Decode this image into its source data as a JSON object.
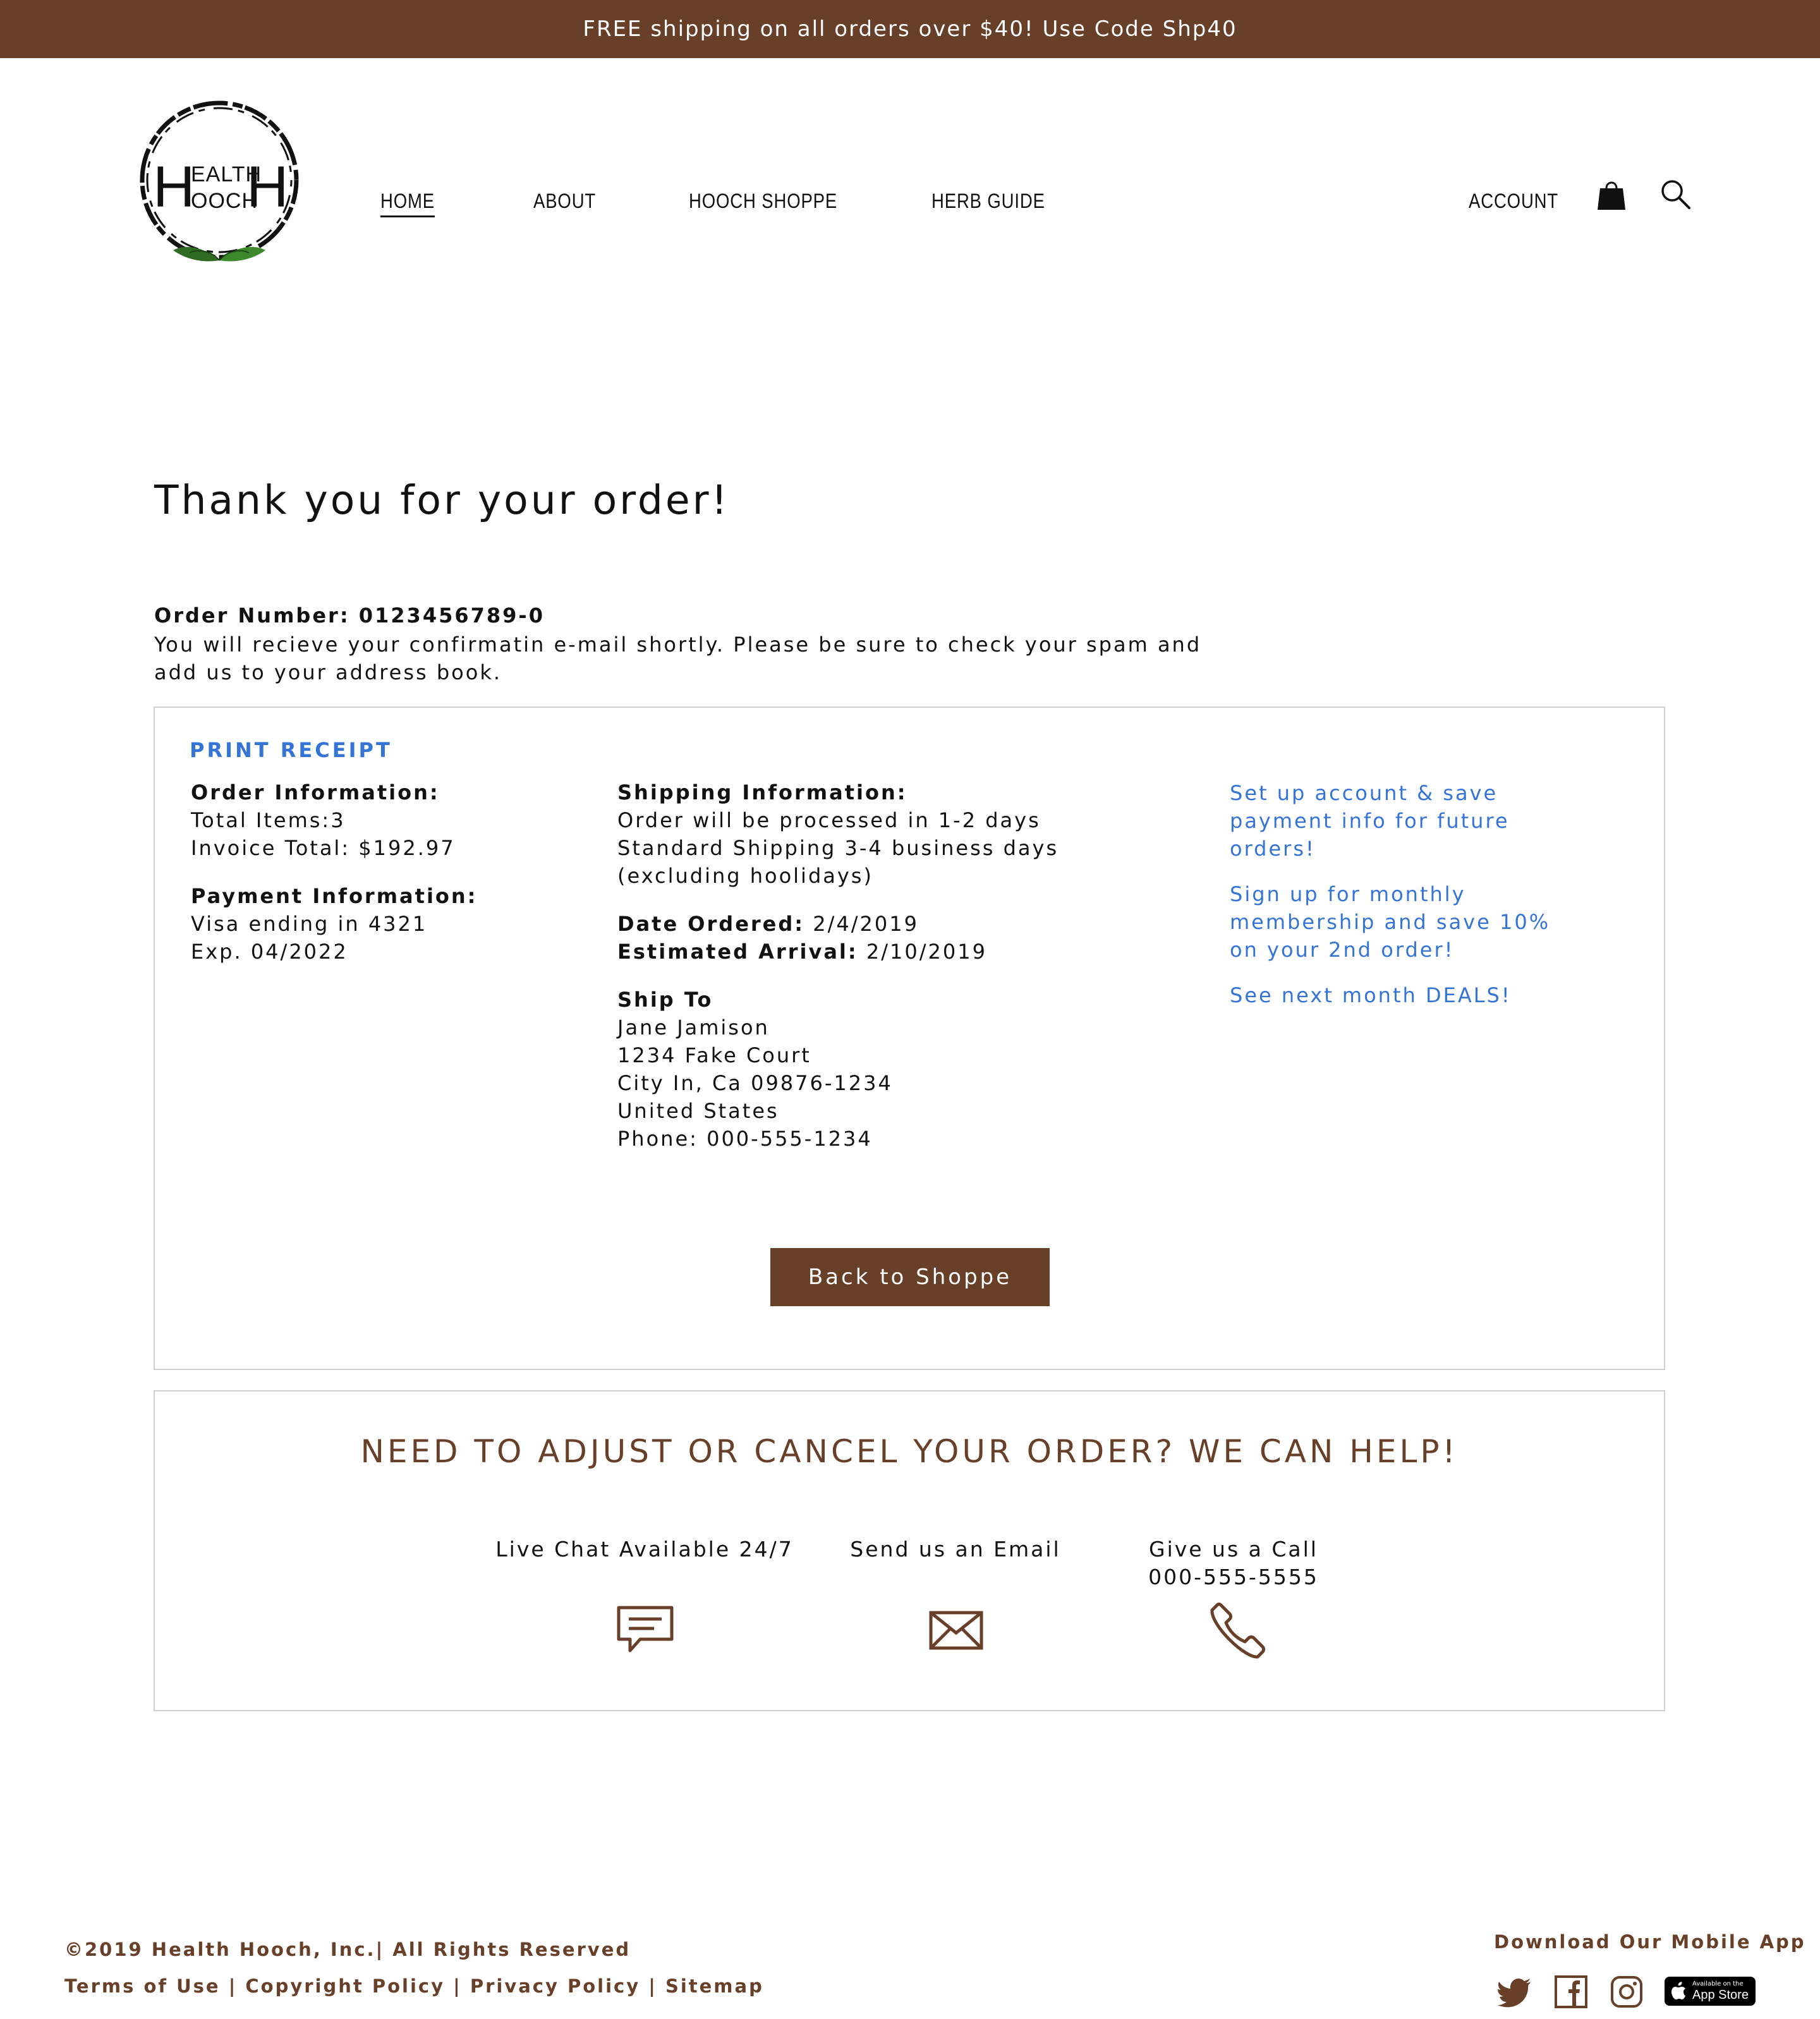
{
  "banner": {
    "text": "FREE shipping on all orders over $40! Use Code Shp40"
  },
  "logo": {
    "line1_big": "H",
    "line1_small": "EALTH",
    "line2_small": "OOCH",
    "line2_big": "H"
  },
  "nav": {
    "home": "HOME",
    "about": "ABOUT",
    "shoppe": "HOOCH SHOPPE",
    "herb_guide": "HERB GUIDE",
    "account": "ACCOUNT",
    "cart_icon": "shopping-bag-icon",
    "search_icon": "search-icon"
  },
  "page": {
    "heading": "Thank you for your order!",
    "order_number": "Order Number: 0123456789-0",
    "confirm_text": "You will recieve your confirmatin e-mail shortly. Please be sure to check your spam and add us to your address book."
  },
  "receipt": {
    "print_label": "PRINT RECEIPT",
    "order_info": {
      "title": "Order Information:",
      "total_items": "Total Items:3",
      "invoice_total": "Invoice Total: $192.97"
    },
    "payment_info": {
      "title": "Payment Information:",
      "card": "Visa ending in 4321",
      "exp": "Exp. 04/2022"
    },
    "shipping_info": {
      "title": "Shipping Information:",
      "line1": "Order will be processed in 1-2 days",
      "line2": "Standard Shipping 3-4 business days",
      "line3": "(excluding hoolidays)"
    },
    "dates": {
      "ordered_label": "Date Ordered:",
      "ordered_value": " 2/4/2019",
      "arrival_label": "Estimated Arrival:",
      "arrival_value": " 2/10/2019"
    },
    "ship_to": {
      "title": "Ship To",
      "name": "Jane Jamison",
      "street": "1234 Fake Court",
      "city": "City In, Ca 09876-1234",
      "country": "United States",
      "phone": "Phone: 000-555-1234"
    },
    "promos": {
      "account": "Set up account & save payment info for future orders!",
      "membership": "Sign up for monthly membership and save 10% on your 2nd order!",
      "deals": "See next month DEALS!"
    },
    "back_button": "Back to Shoppe"
  },
  "help": {
    "title": "NEED TO ADJUST OR CANCEL YOUR ORDER? WE CAN HELP!",
    "chat": "Live Chat Available 24/7",
    "email": "Send us an Email",
    "call": "Give us a Call",
    "phone": "000-555-5555"
  },
  "footer": {
    "copyright": "©2019 Health Hooch, Inc.|  All Rights Reserved",
    "terms": "Terms of Use",
    "copyright_policy": "Copyright Policy",
    "privacy": "Privacy Policy",
    "sitemap": "Sitemap",
    "sep": " | ",
    "app_label": "Download Our Mobile App",
    "appstore_small": "Available on the",
    "appstore_big": "App Store"
  },
  "colors": {
    "brand_brown": "#683f28",
    "link_blue": "#3474d6",
    "border": "#cfcfcf"
  }
}
